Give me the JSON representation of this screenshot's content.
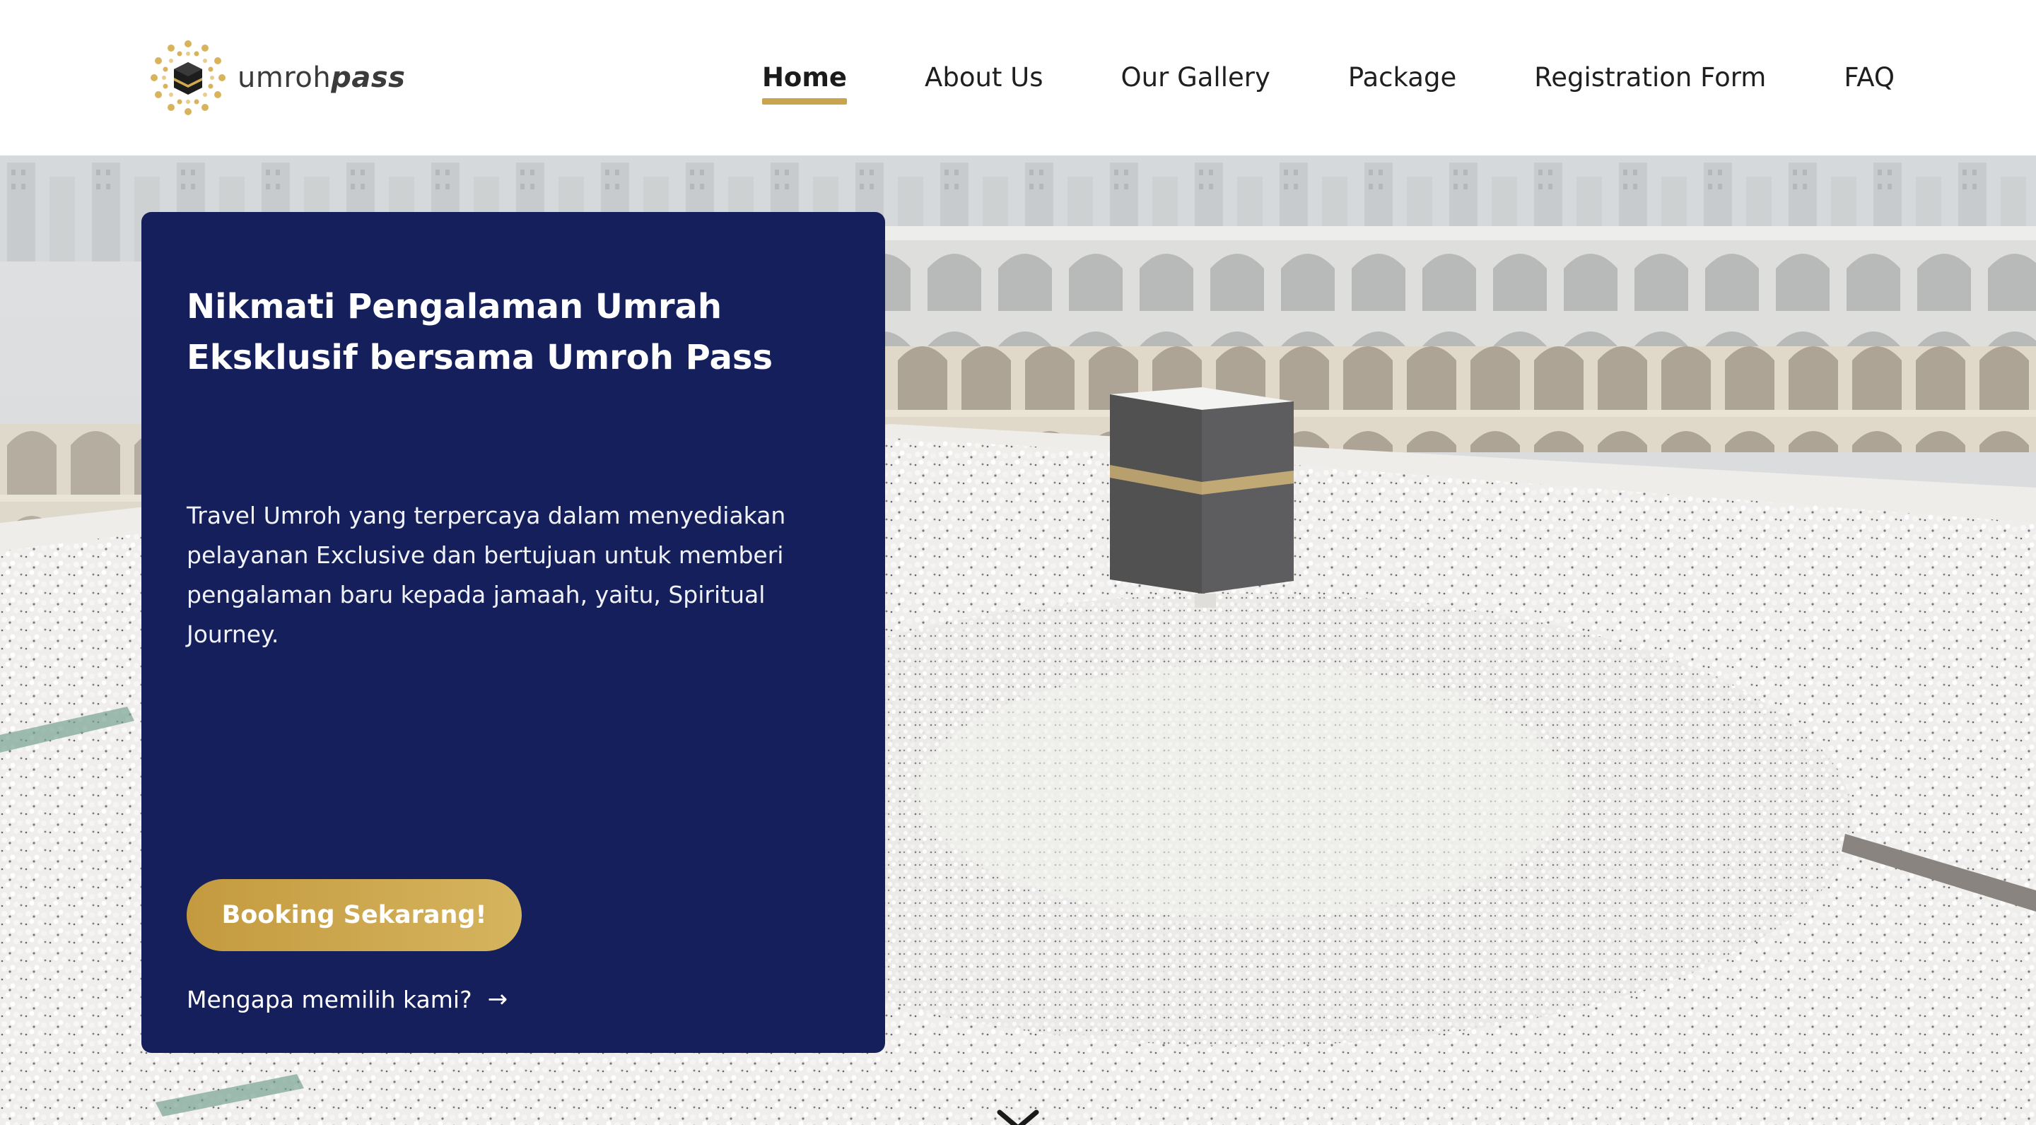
{
  "brand": {
    "name_regular": "umroh",
    "name_bold": "pass",
    "gold": "#c9a44c",
    "navy": "#141f5c"
  },
  "nav": {
    "items": [
      {
        "label": "Home",
        "active": true
      },
      {
        "label": "About Us",
        "active": false
      },
      {
        "label": "Our Gallery",
        "active": false
      },
      {
        "label": "Package",
        "active": false
      },
      {
        "label": "Registration Form",
        "active": false
      },
      {
        "label": "FAQ",
        "active": false
      }
    ]
  },
  "hero": {
    "title": "Nikmati Pengalaman Umrah Eksklusif bersama Umroh Pass",
    "description": "Travel Umroh yang terpercaya dalam menyediakan pelayanan Exclusive dan bertujuan untuk memberi pengalaman baru kepada jamaah, yaitu, Spiritual Journey.",
    "cta_label": "Booking Sekarang!",
    "secondary_link": "Mengapa memilih kami?",
    "secondary_icon": "arrow-right-icon",
    "scroll_icon": "chevron-down-icon"
  }
}
